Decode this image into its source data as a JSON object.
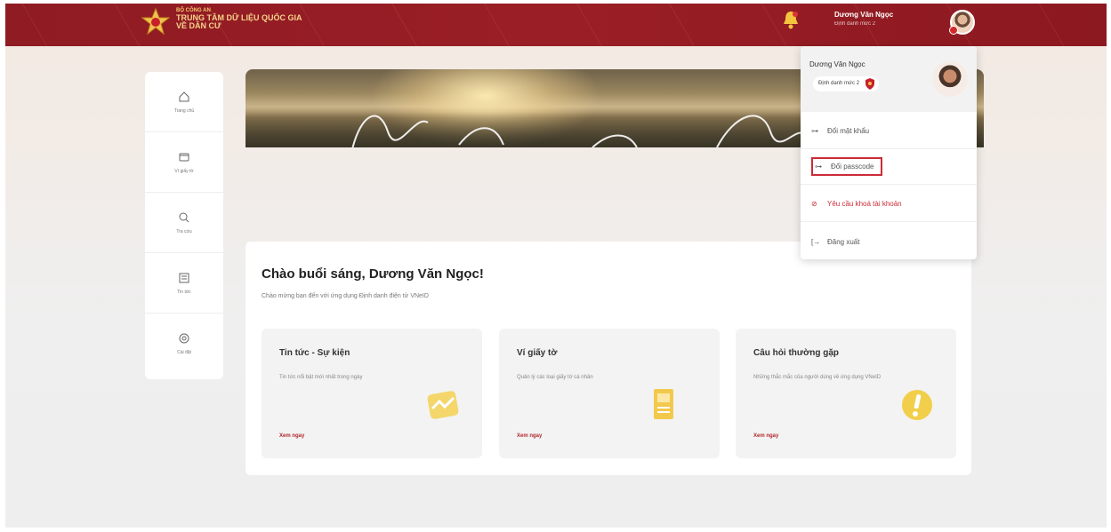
{
  "header": {
    "org_line1": "BỘ CÔNG AN",
    "org_line2": "TRUNG TÂM DỮ LIỆU QUỐC GIA",
    "org_line3": "VỀ DÂN CƯ",
    "user_name": "Dương Văn Ngọc",
    "user_level": "Định danh mức 2"
  },
  "sidebar": {
    "items": [
      {
        "label": "Trang chủ",
        "icon": "home-icon"
      },
      {
        "label": "Ví giấy tờ",
        "icon": "wallet-icon"
      },
      {
        "label": "Tra cứu",
        "icon": "search-icon"
      },
      {
        "label": "Tin tức",
        "icon": "news-icon"
      },
      {
        "label": "Cài đặt",
        "icon": "settings-icon"
      }
    ]
  },
  "main": {
    "greeting": "Chào buổi sáng, Dương Văn Ngọc!",
    "subtitle": "Chào mừng bạn đến với ứng dụng Định danh điện tử VNeID",
    "tiles": [
      {
        "title": "Tin tức - Sự kiện",
        "desc": "Tin tức nổi bật mới nhất trong ngày",
        "more": "Xem ngay"
      },
      {
        "title": "Ví giấy tờ",
        "desc": "Quản lý các loại giấy tờ cá nhân",
        "more": "Xem ngay"
      },
      {
        "title": "Câu hỏi thường gặp",
        "desc": "Những thắc mắc của người dùng về ứng dụng VNeID",
        "more": "Xem ngay"
      }
    ]
  },
  "dropdown": {
    "name": "Dương Văn Ngọc",
    "badge": "Định danh mức 2",
    "items": [
      {
        "label": "Đổi mật khẩu",
        "icon": "key-icon"
      },
      {
        "label": "Đổi passcode",
        "icon": "key-icon"
      },
      {
        "label": "Yêu cầu khoá tài khoản",
        "icon": "ban-icon"
      },
      {
        "label": "Đăng xuất",
        "icon": "logout-icon"
      }
    ]
  },
  "colors": {
    "header": "#8f1b23",
    "accent_red": "#cc2b36",
    "gold": "#f6d38b"
  }
}
